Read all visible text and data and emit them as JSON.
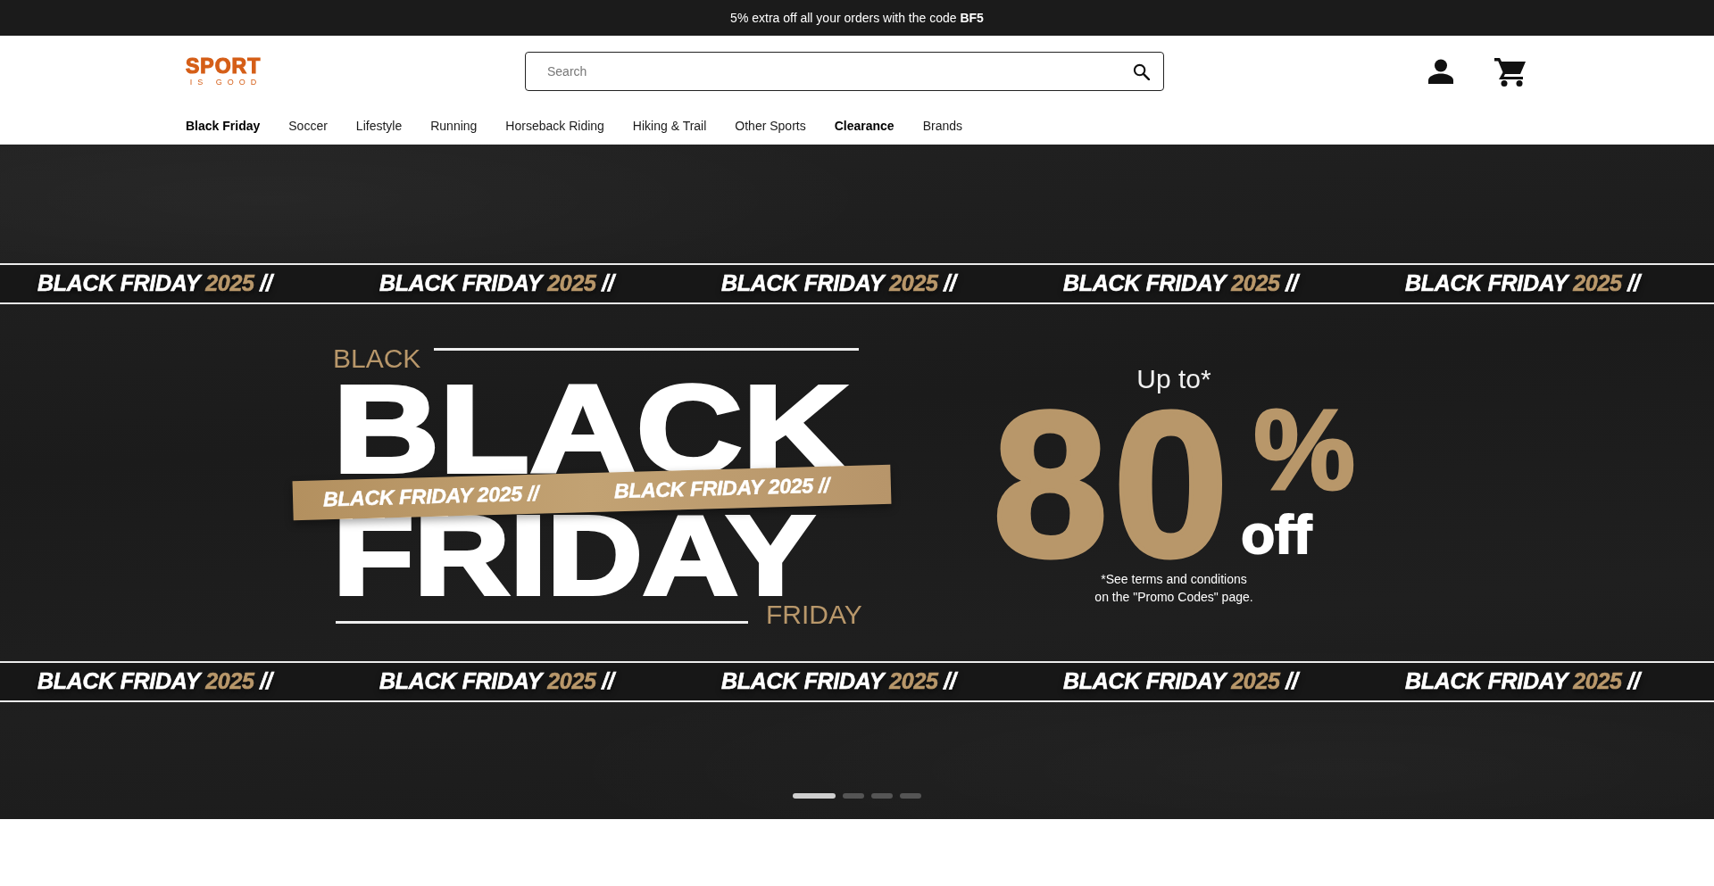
{
  "announcement_bar": {
    "text": "5% extra off all your orders with the code **BF5**"
  },
  "header": {
    "logo": {
      "wordmark": "SPORT",
      "tagline": "IS GOOD"
    },
    "search": {
      "placeholder": "Search"
    }
  },
  "nav": {
    "items": [
      {
        "label": "Black Friday",
        "highlighted": true
      },
      {
        "label": "Soccer",
        "highlighted": false
      },
      {
        "label": "Lifestyle",
        "highlighted": false
      },
      {
        "label": "Running",
        "highlighted": false
      },
      {
        "label": "Horseback Riding",
        "highlighted": false
      },
      {
        "label": "Hiking & Trail",
        "highlighted": false
      },
      {
        "label": "Other Sports",
        "highlighted": false
      },
      {
        "label": "Clearance",
        "highlighted": true
      },
      {
        "label": "Brands",
        "highlighted": false
      }
    ]
  },
  "hero": {
    "top_strip": {
      "slogans": [
        {
          "title": "BLACK FRIDAY",
          "year": "2025",
          "separator": "//"
        },
        {
          "title": "BLACK FRIDAY",
          "year": "2025",
          "separator": "//"
        },
        {
          "title": "BLACK FRIDAY",
          "year": "2025",
          "separator": "//"
        },
        {
          "title": "BLACK FRIDAY",
          "year": "2025",
          "separator": "//"
        },
        {
          "title": "BLACK FRIDAY",
          "year": "2025",
          "separator": "//"
        }
      ]
    },
    "headline": {
      "small_top": "BLACK",
      "big_top": "BLACK",
      "tape": {
        "slogans": [
          {
            "title": "BLACK FRIDAY",
            "year": "2025",
            "separator": "//"
          },
          {
            "title": "BLACK FRIDAY",
            "year": "2025",
            "separator": "//"
          }
        ]
      },
      "big_bottom": "FRIDAY",
      "small_bottom": "FRIDAY"
    },
    "offer": {
      "lead": "Up to*",
      "amount": "80",
      "percent": "%",
      "suffix": "off",
      "terms": "*See terms and conditions\non the \"Promo Codes\" page."
    },
    "bottom_strip": {
      "slogans": [
        {
          "title": "BLACK FRIDAY",
          "year": "2025",
          "separator": "//"
        },
        {
          "title": "BLACK FRIDAY",
          "year": "2025",
          "separator": "//"
        },
        {
          "title": "BLACK FRIDAY",
          "year": "2025",
          "separator": "//"
        },
        {
          "title": "BLACK FRIDAY",
          "year": "2025",
          "separator": "//"
        },
        {
          "title": "BLACK FRIDAY",
          "year": "2025",
          "separator": "//"
        }
      ]
    },
    "carousel": {
      "dots": [
        {
          "selected": true
        },
        {
          "selected": false
        },
        {
          "selected": false
        },
        {
          "selected": false
        }
      ]
    }
  }
}
